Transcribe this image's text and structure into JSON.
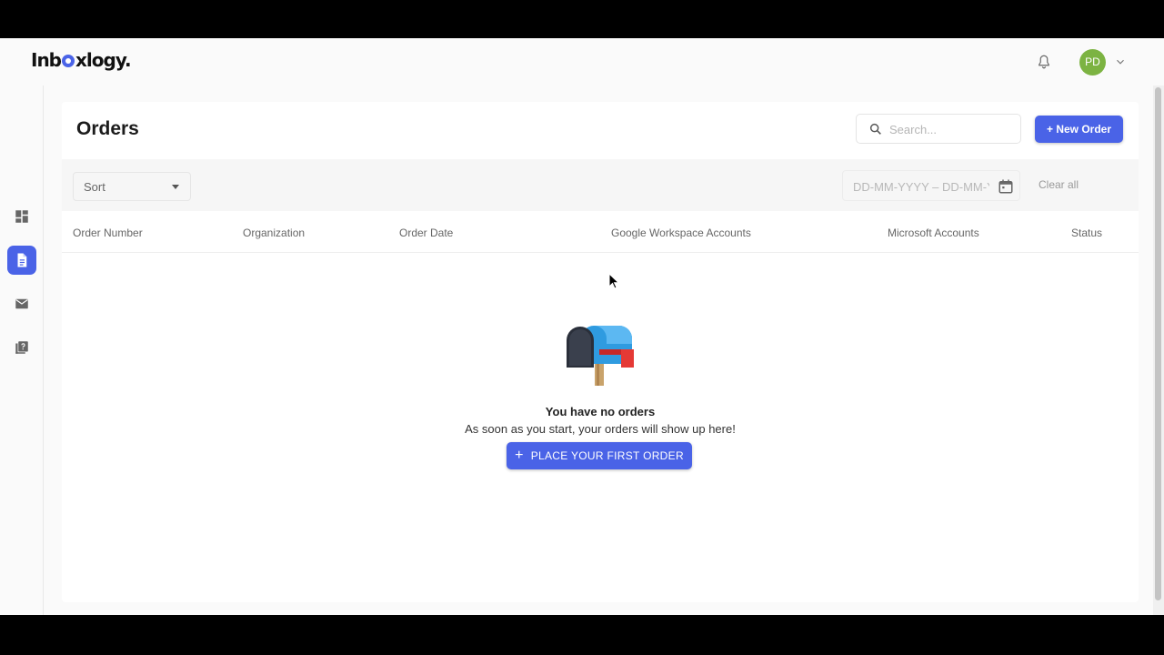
{
  "header": {
    "logo_text_1": "Inb",
    "logo_text_2": "xlogy.",
    "logo_tagline": "",
    "avatar_initials": "PD"
  },
  "sidebar": {
    "items": [
      {
        "name": "dashboard",
        "icon": "dashboard-icon",
        "active": false
      },
      {
        "name": "orders",
        "icon": "document-icon",
        "active": true
      },
      {
        "name": "mail",
        "icon": "mail-icon",
        "active": false
      },
      {
        "name": "help",
        "icon": "help-book-icon",
        "active": false
      }
    ]
  },
  "main": {
    "title": "Orders",
    "search_placeholder": "Search...",
    "new_order_label": "+ New Order",
    "filters": {
      "sort_label": "Sort",
      "date_placeholder": "DD-MM-YYYY – DD-MM-YYYY",
      "clear_all_label": "Clear all"
    },
    "table": {
      "columns": [
        "Order Number",
        "Organization",
        "Order Date",
        "Google Workspace Accounts",
        "Microsoft Accounts",
        "Status"
      ]
    },
    "empty_state": {
      "title": "You have no orders",
      "subtitle": "As soon as you start, your orders will show up here!",
      "button_label": "PLACE YOUR FIRST ORDER"
    }
  },
  "colors": {
    "accent": "#4a63e7",
    "avatar": "#7cb342",
    "mailbox_blue": "#2f9be0",
    "mailbox_flag": "#e53935"
  }
}
